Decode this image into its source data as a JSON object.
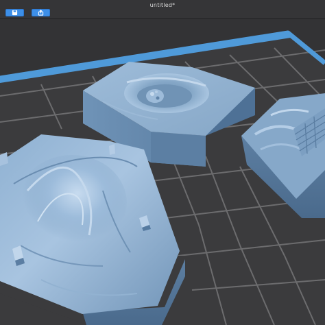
{
  "window": {
    "title": "untitled*"
  },
  "toolbar": {
    "buttons": [
      {
        "icon": "save-icon"
      },
      {
        "icon": "share-icon"
      }
    ]
  },
  "scene": {
    "colors": {
      "background": "#2f2f31",
      "grid_floor": "#3a3a3c",
      "grid_line": "#6a6a6c",
      "plate_border": "#4f9ad9",
      "model_light": "#a9c6e2",
      "model_mid": "#7ea3c6",
      "model_dark": "#4b6f92"
    },
    "objects": [
      "terrain-tile-mountain",
      "terrain-tile-crater",
      "terrain-tile-ruins"
    ]
  }
}
